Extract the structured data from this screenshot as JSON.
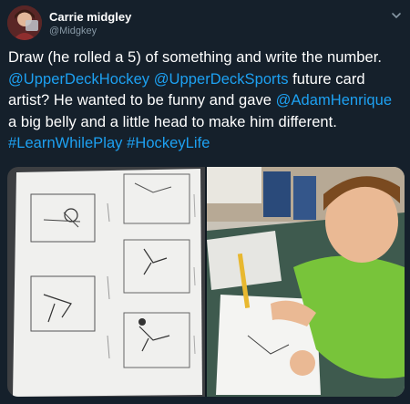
{
  "user": {
    "name": "Carrie midgley",
    "handle": "@Midgkey"
  },
  "tweet": {
    "text_1": "Draw (he rolled a 5) of something and write the number. ",
    "mention_1": "@UpperDeckHockey",
    "space_1": " ",
    "mention_2": "@UpperDeckSports",
    "text_2": " future card artist? He wanted to be funny and gave ",
    "mention_3": "@AdamHenrique",
    "text_3": " a big belly and a little head to make him different. ",
    "hashtag_1": "#LearnWhilePlay",
    "space_2": " ",
    "hashtag_2": "#HockeyLife"
  },
  "colors": {
    "background": "#15202b",
    "link": "#1da1f2",
    "secondary_text": "#8899a6"
  },
  "icons": {
    "menu": "chevron-down-icon"
  },
  "media": {
    "count": 2
  }
}
